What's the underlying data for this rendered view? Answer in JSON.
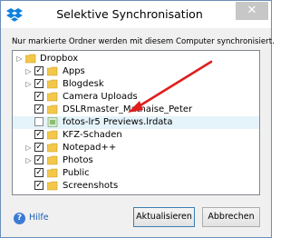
{
  "window": {
    "title": "Selektive Synchronisation",
    "close_glyph": "✕"
  },
  "instruction": "Nur markierte Ordner werden mit diesem Computer synchronisiert.",
  "tree": {
    "root": {
      "label": "Dropbox",
      "expander": "▷",
      "checked": false
    },
    "items": [
      {
        "label": "Apps",
        "expander": "▷",
        "checked": true
      },
      {
        "label": "Blogdesk",
        "expander": "▷",
        "checked": true
      },
      {
        "label": "Camera Uploads",
        "expander": "",
        "checked": true
      },
      {
        "label": "DSLRmaster_Mathaise_Peter",
        "expander": "",
        "checked": true
      },
      {
        "label": "fotos-lr5 Previews.lrdata",
        "expander": "",
        "checked": false,
        "selected": true
      },
      {
        "label": "KFZ-Schaden",
        "expander": "",
        "checked": true
      },
      {
        "label": "Notepad++",
        "expander": "▷",
        "checked": true
      },
      {
        "label": "Photos",
        "expander": "▷",
        "checked": true
      },
      {
        "label": "Public",
        "expander": "",
        "checked": true
      },
      {
        "label": "Screenshots",
        "expander": "",
        "checked": true
      }
    ],
    "check_glyph": "✓"
  },
  "help": {
    "icon": "?",
    "label": "Hilfe"
  },
  "buttons": {
    "update": "Aktualisieren",
    "cancel": "Abbrechen"
  },
  "colors": {
    "arrow": "#e01e1e",
    "folder": "#f3c84a",
    "accent": "#3c7fb1"
  }
}
